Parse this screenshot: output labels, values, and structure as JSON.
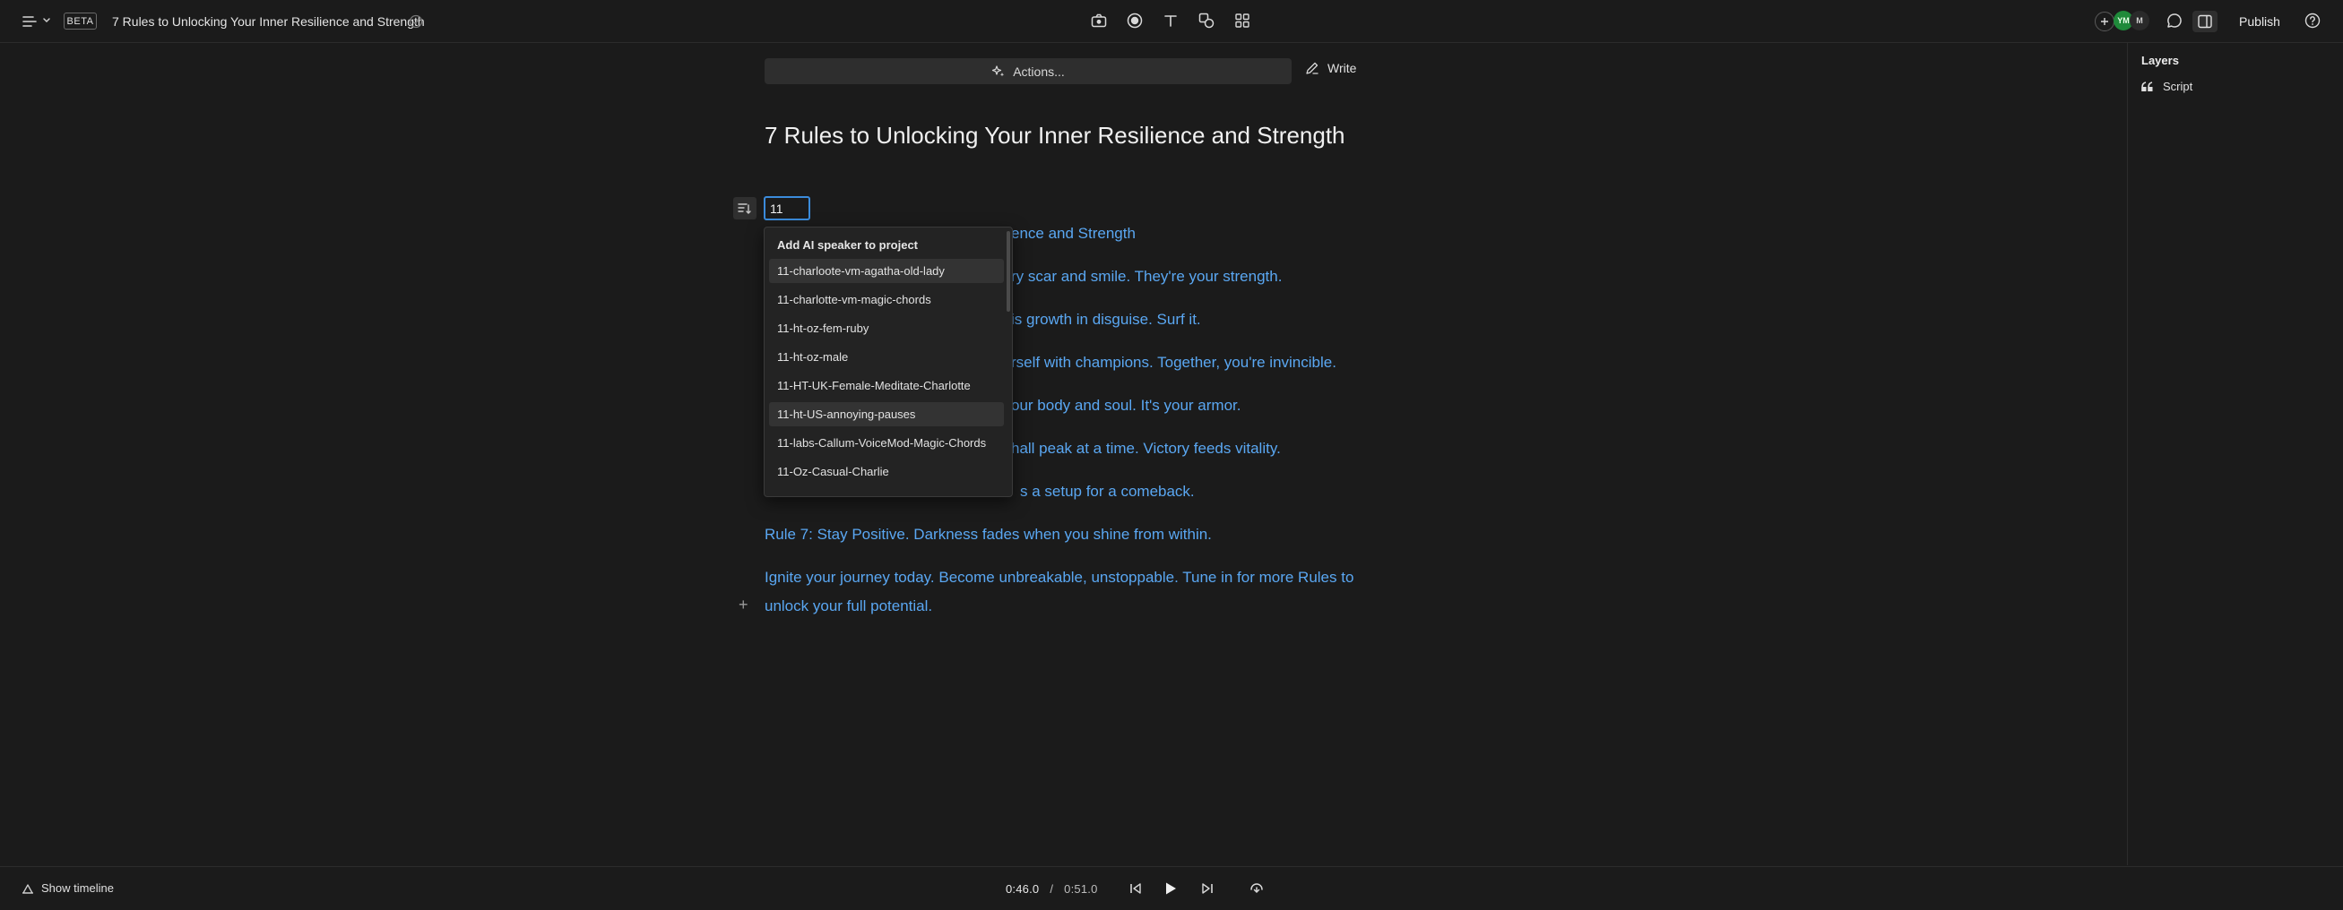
{
  "topbar": {
    "beta_label": "BETA",
    "doc_title": "7 Rules to Unlocking Your Inner Resilience and Strength",
    "publish_label": "Publish",
    "avatars": [
      "YM",
      "M"
    ]
  },
  "editor": {
    "actions_label": "Actions...",
    "write_label": "Write",
    "page_title": "7 Rules to Unlocking Your Inner Resilience and Strength",
    "speaker_input_value": "11",
    "script_lines": [
      "ence and Strength",
      "ry scar and smile. They're your strength.",
      "is growth in disguise. Surf it.",
      "rself with champions. Together, you're invincible.",
      "our body and soul. It's your armor.",
      "hall peak at a time. Victory feeds vitality.",
      "s a setup for a comeback.",
      "Rule 7: Stay Positive. Darkness fades when you shine from within.",
      "Ignite your journey today. Become unbreakable, unstoppable. Tune in for more Rules to",
      "unlock your full potential."
    ]
  },
  "dropdown": {
    "header": "Add AI speaker to project",
    "items": [
      "11-charloote-vm-agatha-old-lady",
      "11-charlotte-vm-magic-chords",
      "11-ht-oz-fem-ruby",
      "11-ht-oz-male",
      "11-HT-UK-Female-Meditate-Charlotte",
      "11-ht-US-annoying-pauses",
      "11-labs-Callum-VoiceMod-Magic-Chords",
      "11-Oz-Casual-Charlie"
    ],
    "highlighted": [
      0,
      5
    ]
  },
  "right_panel": {
    "title": "Layers",
    "items": [
      "Script"
    ]
  },
  "bottombar": {
    "show_timeline_label": "Show timeline",
    "current_time": "0:46.0",
    "separator": "/",
    "total_time": "0:51.0"
  },
  "colors": {
    "background": "#1b1b1b",
    "script_text": "#5aa7f2",
    "focus_border": "#3b8bdb",
    "avatar_green": "#1f8a3a"
  },
  "icons": [
    "menu-icon",
    "chevron-down-icon",
    "check-circle-icon",
    "camera-icon",
    "record-icon",
    "text-icon",
    "shapes-icon",
    "grid-icon",
    "add-icon",
    "comment-icon",
    "sidebar-toggle-icon",
    "help-icon",
    "sparkle-icon",
    "pen-icon",
    "quote-icon",
    "paragraph-icon",
    "timeline-icon",
    "skip-back-icon",
    "play-icon",
    "skip-forward-icon",
    "loop-icon"
  ]
}
